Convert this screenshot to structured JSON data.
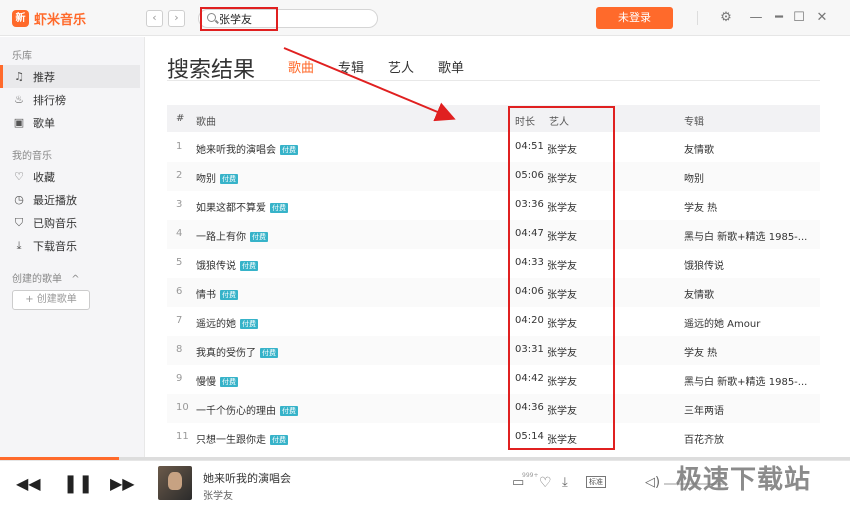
{
  "app": {
    "name": "虾米音乐",
    "logo_glyph": "新",
    "accent": "#ff6a2b"
  },
  "topbar": {
    "back": "‹",
    "forward": "›",
    "search_value": "张学友",
    "login_label": "未登录"
  },
  "sidebar": {
    "section_library": "乐库",
    "library": [
      {
        "icon": "music-note-icon",
        "glyph": "♫",
        "label": "推荐",
        "active": true
      },
      {
        "icon": "flame-icon",
        "glyph": "♨",
        "label": "排行榜"
      },
      {
        "icon": "screen-icon",
        "glyph": "▣",
        "label": "歌单"
      }
    ],
    "section_mine": "我的音乐",
    "mine": [
      {
        "icon": "heart-icon",
        "glyph": "♡",
        "label": "收藏"
      },
      {
        "icon": "clock-icon",
        "glyph": "◷",
        "label": "最近播放"
      },
      {
        "icon": "cart-icon",
        "glyph": "⛉",
        "label": "已购音乐"
      },
      {
        "icon": "download-icon",
        "glyph": "⤓",
        "label": "下载音乐"
      }
    ],
    "section_created": "创建的歌单",
    "section_created_chevron": "^",
    "create_label": "+ 创建歌单"
  },
  "main": {
    "title": "搜索结果",
    "tabs": [
      "歌曲",
      "专辑",
      "艺人",
      "歌单"
    ],
    "columns": {
      "num": "#",
      "song": "歌曲",
      "duration": "时长",
      "artist": "艺人",
      "album": "专辑"
    },
    "paid_label": "付费",
    "rows": [
      {
        "num": "1",
        "song": "她来听我的演唱会",
        "duration": "04:51",
        "artist": "张学友",
        "album": "友情歌"
      },
      {
        "num": "2",
        "song": "吻别",
        "duration": "05:06",
        "artist": "张学友",
        "album": "吻别"
      },
      {
        "num": "3",
        "song": "如果这都不算爱",
        "duration": "03:36",
        "artist": "张学友",
        "album": "学友 热"
      },
      {
        "num": "4",
        "song": "一路上有你",
        "duration": "04:47",
        "artist": "张学友",
        "album": "黑与白 新歌+精选 1985-..."
      },
      {
        "num": "5",
        "song": "饿狼传说",
        "duration": "04:33",
        "artist": "张学友",
        "album": "饿狼传说"
      },
      {
        "num": "6",
        "song": "情书",
        "duration": "04:06",
        "artist": "张学友",
        "album": "友情歌"
      },
      {
        "num": "7",
        "song": "遥远的她",
        "duration": "04:20",
        "artist": "张学友",
        "album": "遥远的她 Amour"
      },
      {
        "num": "8",
        "song": "我真的受伤了",
        "duration": "03:31",
        "artist": "张学友",
        "album": "学友 热"
      },
      {
        "num": "9",
        "song": "慢慢",
        "duration": "04:42",
        "artist": "张学友",
        "album": "黑与白 新歌+精选 1985-..."
      },
      {
        "num": "10",
        "song": "一千个伤心的理由",
        "duration": "04:36",
        "artist": "张学友",
        "album": "三年两语"
      },
      {
        "num": "11",
        "song": "只想一生跟你走",
        "duration": "05:14",
        "artist": "张学友",
        "album": "百花齐放"
      }
    ]
  },
  "player": {
    "now_title": "她来听我的演唱会",
    "now_artist": "张学友",
    "comment_count": "999+",
    "quality_label": "标准",
    "progress": 0.14
  },
  "watermark": "极速下载站"
}
